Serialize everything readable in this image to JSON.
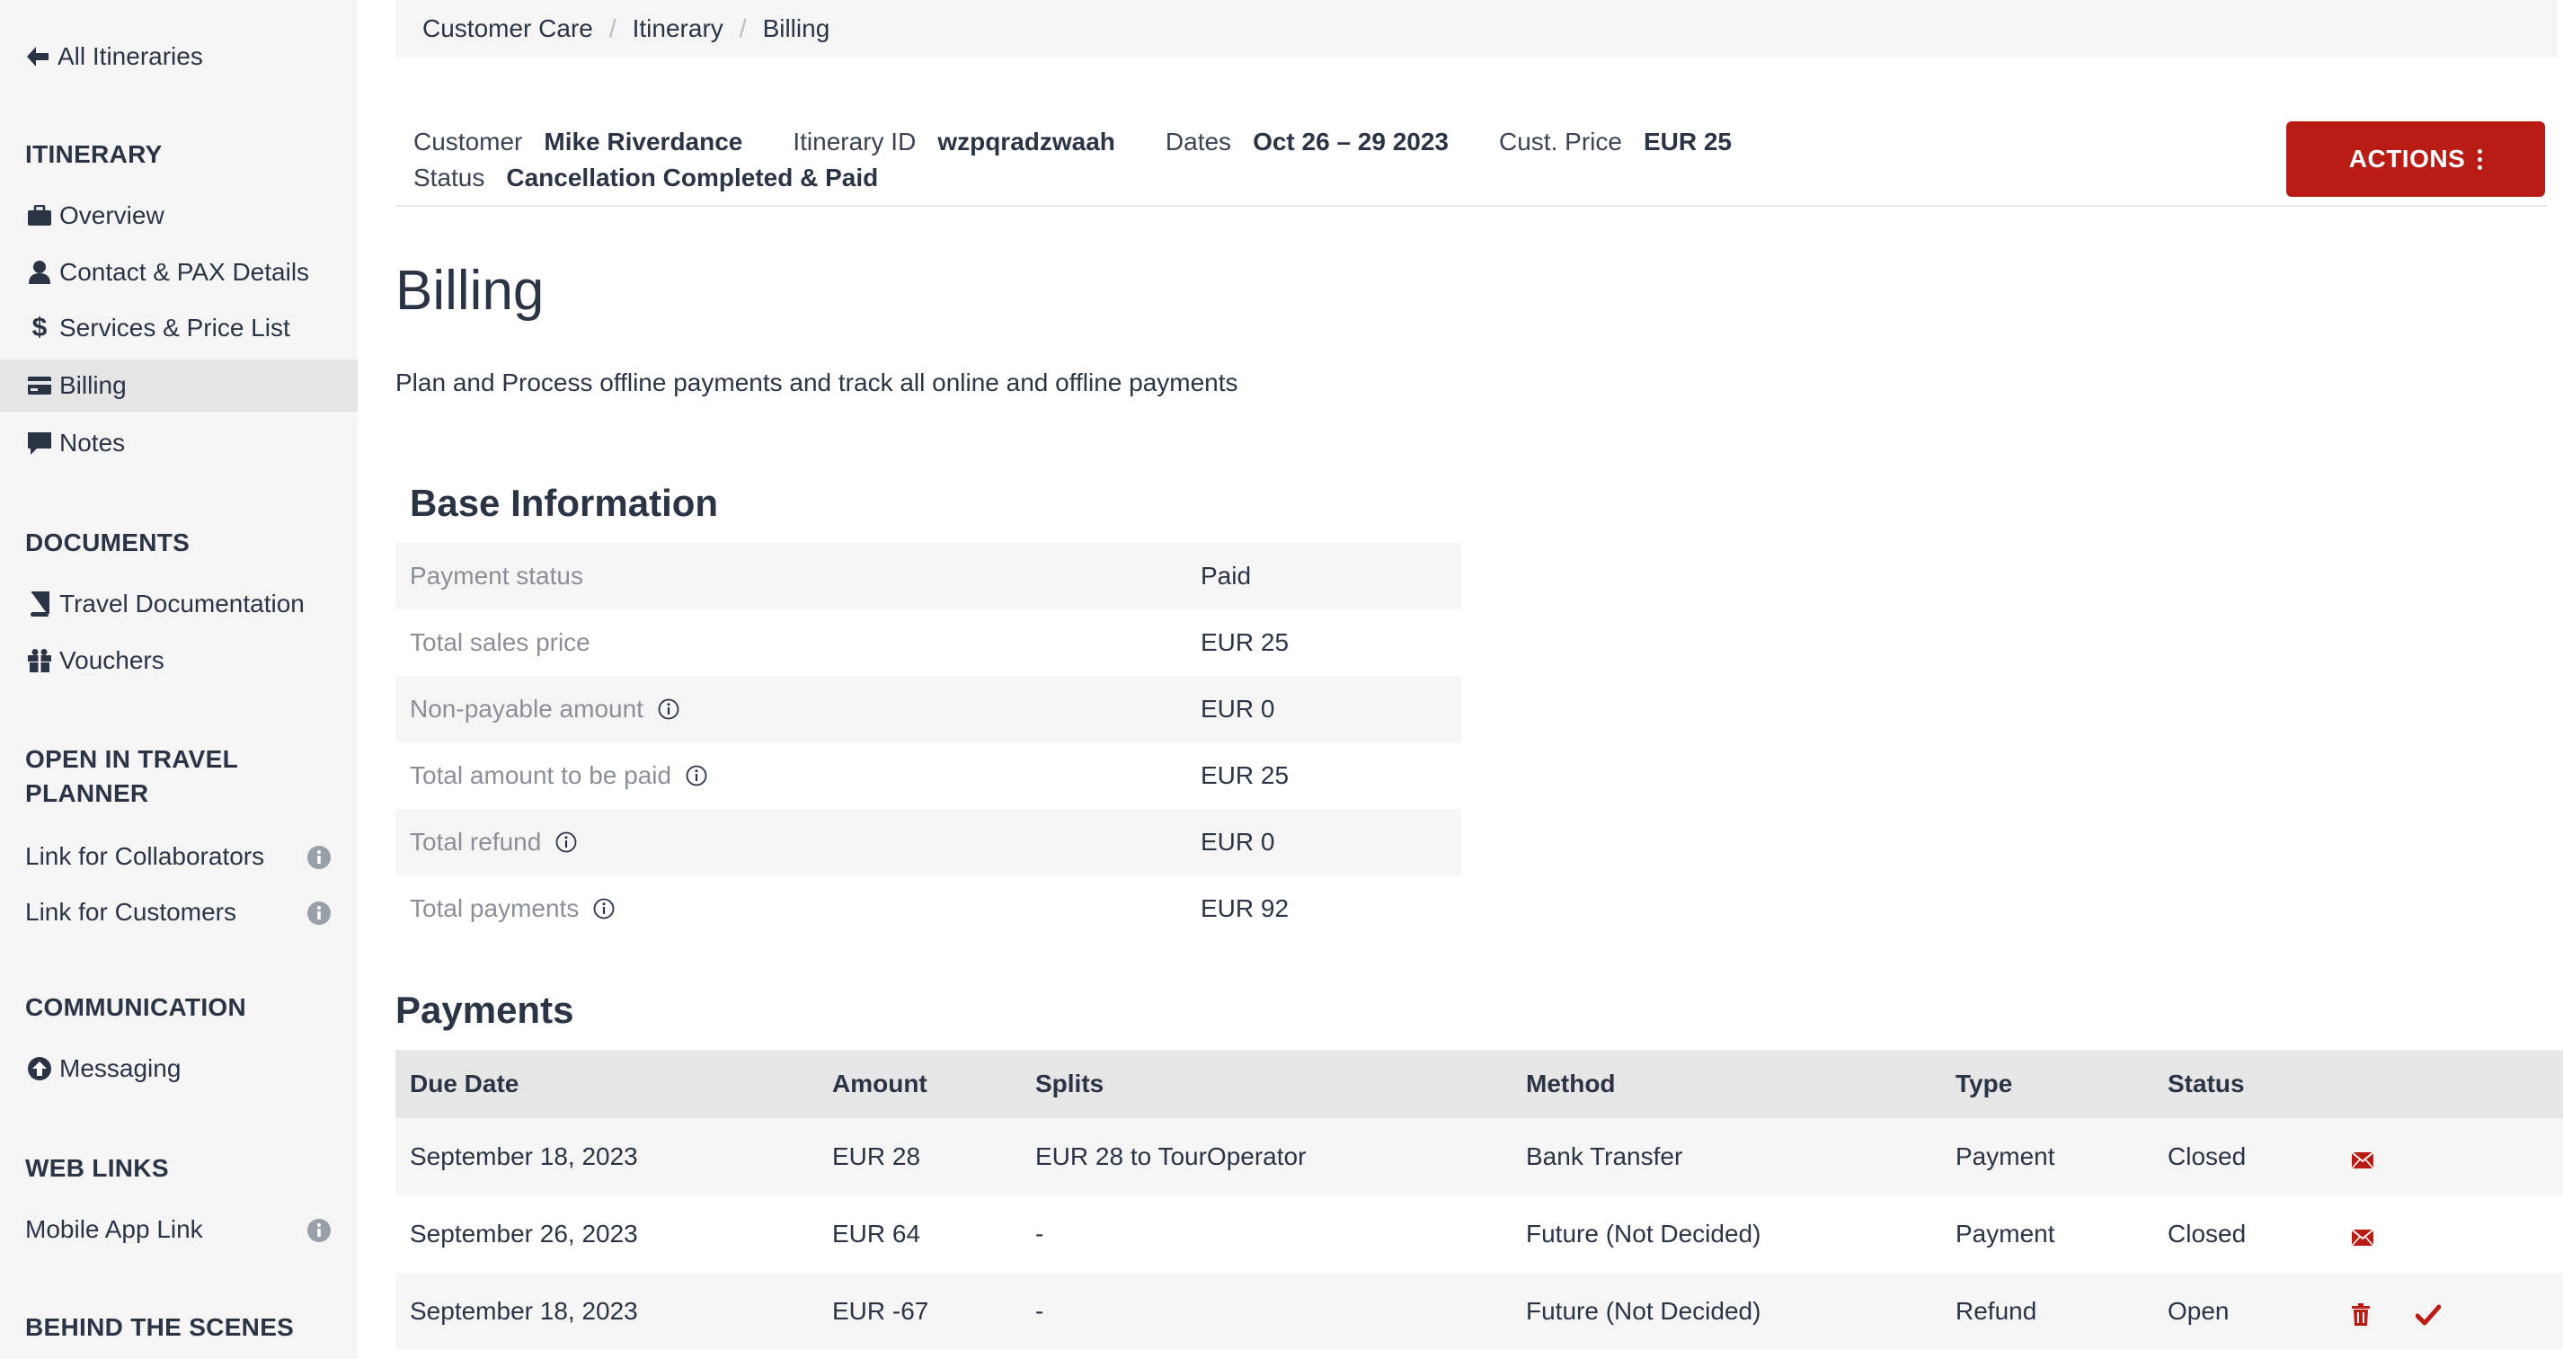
{
  "sidebar": {
    "back_label": "All Itineraries",
    "sections": {
      "itinerary": "ITINERARY",
      "documents": "DOCUMENTS",
      "open_in_travel_planner": "OPEN IN TRAVEL PLANNER",
      "communication": "COMMUNICATION",
      "web_links": "WEB LINKS",
      "behind_the_scenes": "BEHIND THE SCENES"
    },
    "items": {
      "overview": "Overview",
      "contact": "Contact & PAX Details",
      "services": "Services & Price List",
      "billing": "Billing",
      "notes": "Notes",
      "travel_docs": "Travel Documentation",
      "vouchers": "Vouchers",
      "link_collaborators": "Link for Collaborators",
      "link_customers": "Link for Customers",
      "messaging": "Messaging",
      "mobile_app": "Mobile App Link"
    },
    "active_item": "Billing"
  },
  "breadcrumb": [
    "Customer Care",
    "Itinerary",
    "Billing"
  ],
  "summary": {
    "customer_label": "Customer",
    "customer": "Mike Riverdance",
    "itinerary_id_label": "Itinerary ID",
    "itinerary_id": "wzpqradzwaah",
    "dates_label": "Dates",
    "dates": "Oct 26 – 29 2023",
    "price_label": "Cust. Price",
    "price": "EUR 25",
    "status_label": "Status",
    "status": "Cancellation Completed & Paid"
  },
  "actions_label": "ACTIONS",
  "page": {
    "title": "Billing",
    "description": "Plan and Process offline payments and track all online and offline payments"
  },
  "base_info": {
    "title": "Base Information",
    "rows": [
      {
        "label": "Payment status",
        "value": "Paid",
        "info": false
      },
      {
        "label": "Total sales price",
        "value": "EUR 25",
        "info": false
      },
      {
        "label": "Non-payable amount",
        "value": "EUR 0",
        "info": true
      },
      {
        "label": "Total amount to be paid",
        "value": "EUR 25",
        "info": true
      },
      {
        "label": "Total refund",
        "value": "EUR 0",
        "info": true
      },
      {
        "label": "Total payments",
        "value": "EUR 92",
        "info": true
      }
    ]
  },
  "payments": {
    "title": "Payments",
    "columns": [
      "Due Date",
      "Amount",
      "Splits",
      "Method",
      "Type",
      "Status"
    ],
    "rows": [
      {
        "due": "September 18, 2023",
        "amount": "EUR 28",
        "splits": "EUR 28 to TourOperator",
        "method": "Bank Transfer",
        "type": "Payment",
        "status": "Closed",
        "actions": [
          "email-icon"
        ]
      },
      {
        "due": "September 26, 2023",
        "amount": "EUR 64",
        "splits": "-",
        "method": "Future (Not Decided)",
        "type": "Payment",
        "status": "Closed",
        "actions": [
          "email-icon"
        ]
      },
      {
        "due": "September 18, 2023",
        "amount": "EUR -67",
        "splits": "-",
        "method": "Future (Not Decided)",
        "type": "Refund",
        "status": "Open",
        "actions": [
          "trash-icon",
          "checkmark-icon"
        ]
      }
    ]
  },
  "colors": {
    "accent": "#b91c14",
    "text": "#2b3445",
    "muted": "#8a8f98",
    "sidebar_bg": "#f5f5f6"
  }
}
